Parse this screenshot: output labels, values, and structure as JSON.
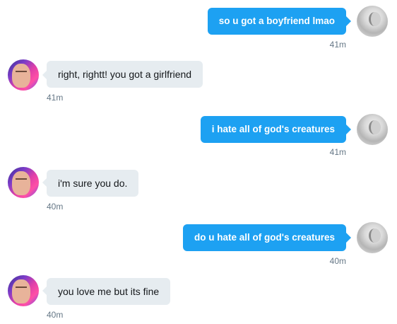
{
  "messages": [
    {
      "direction": "sent",
      "text": "so u got a boyfriend lmao",
      "time": "41m"
    },
    {
      "direction": "received",
      "text": "right, rightt! you got a girlfriend",
      "time": "41m"
    },
    {
      "direction": "sent",
      "text": "i hate all of god's creatures",
      "time": "41m"
    },
    {
      "direction": "received",
      "text": "i'm sure you do.",
      "time": "40m"
    },
    {
      "direction": "sent",
      "text": "do u hate all of god's creatures",
      "time": "40m"
    },
    {
      "direction": "received",
      "text": "you love me but its fine",
      "time": "40m"
    }
  ],
  "colors": {
    "sent_bubble": "#1da1f2",
    "received_bubble": "#e6ecf0",
    "timestamp": "#657786"
  }
}
